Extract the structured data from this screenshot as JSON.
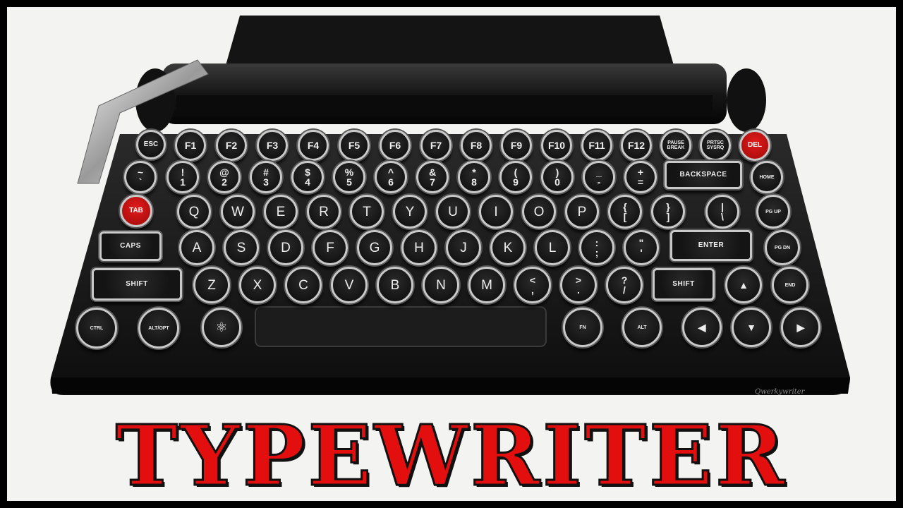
{
  "title": "TYPEWRITER",
  "brand": "Qwerkywriter",
  "keys": {
    "row_fn": [
      "ESC",
      "F1",
      "F2",
      "F3",
      "F4",
      "F5",
      "F6",
      "F7",
      "F8",
      "F9",
      "F10",
      "F11",
      "F12",
      "PAUSE\nBREAK",
      "PRTSC\nSYSRQ",
      "DEL"
    ],
    "row_num": [
      "~\n`",
      "!\n1",
      "@\n2",
      "#\n3",
      "$\n4",
      "%\n5",
      "^\n6",
      "&\n7",
      "*\n8",
      "(\n9",
      ")\n0",
      "_\n-",
      "+\n="
    ],
    "backspace": "BACKSPACE",
    "home": "HOME",
    "tab": "TAB",
    "row_q": [
      "Q",
      "W",
      "E",
      "R",
      "T",
      "Y",
      "U",
      "I",
      "O",
      "P",
      "{\n[",
      "}\n]",
      "|\n\\"
    ],
    "pgup": "PG UP",
    "caps": "CAPS",
    "row_a": [
      "A",
      "S",
      "D",
      "F",
      "G",
      "H",
      "J",
      "K",
      "L",
      ":\n;",
      "\"\n'"
    ],
    "enter": "ENTER",
    "pgdn": "PG DN",
    "shift_left": "SHIFT",
    "row_z": [
      "Z",
      "X",
      "C",
      "V",
      "B",
      "N",
      "M",
      "<\n,",
      ">\n.",
      "?\n/"
    ],
    "shift_right": "SHIFT",
    "up": "▲",
    "end": "END",
    "ctrl": "CTRL",
    "altopt": "ALT/OPT",
    "atom": "⚛",
    "fn": "FN",
    "alt": "ALT",
    "left": "◀",
    "down": "▼",
    "right": "▶"
  }
}
